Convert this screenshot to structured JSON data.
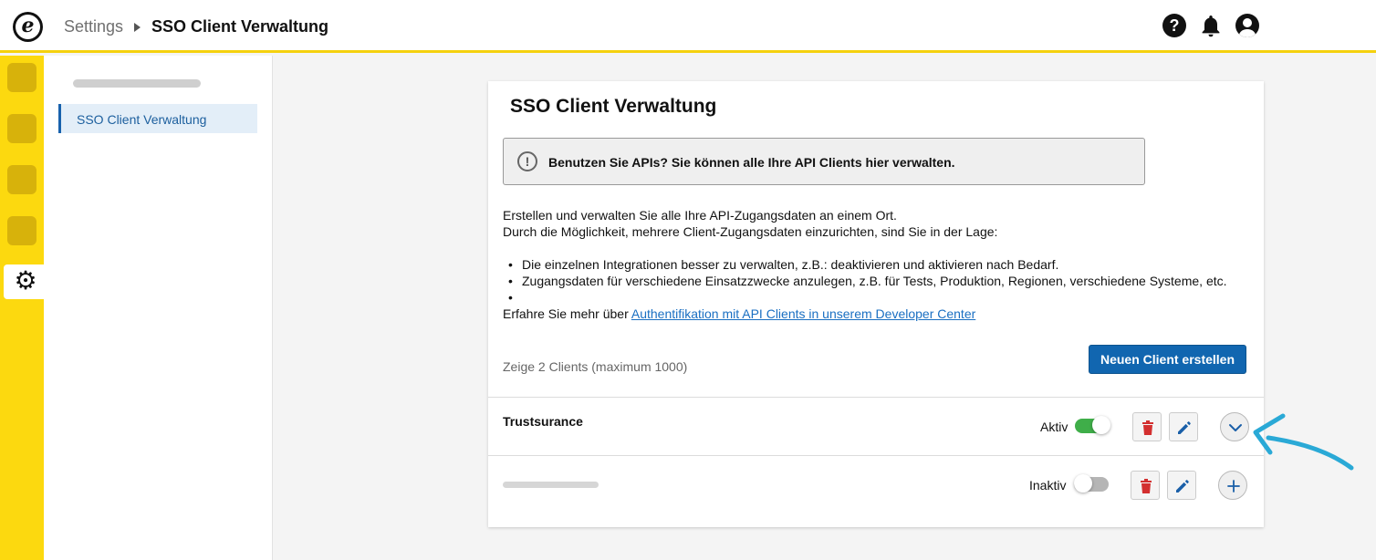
{
  "header": {
    "logo_letter": "e",
    "breadcrumb_root": "Settings",
    "breadcrumb_current": "SSO Client Verwaltung",
    "icons": [
      "help-icon",
      "bell-icon",
      "user-icon"
    ]
  },
  "rail": {
    "items": [
      "rail-item-1",
      "rail-item-2",
      "rail-item-3",
      "rail-item-4"
    ],
    "active_icon": "gear-icon"
  },
  "sidebar": {
    "items": [
      {
        "label": "SSO Client Verwaltung",
        "active": true
      }
    ]
  },
  "card": {
    "title": "SSO Client Verwaltung",
    "info": "Benutzen Sie APIs? Sie können alle Ihre API Clients hier verwalten.",
    "description": [
      "Erstellen und verwalten Sie alle Ihre API-Zugangsdaten an einem Ort.",
      "Durch die Möglichkeit, mehrere Client-Zugangsdaten einzurichten, sind Sie in der Lage:"
    ],
    "bullets": [
      "Die einzelnen Integrationen besser zu verwalten, z.B.: deaktivieren und aktivieren nach Bedarf.",
      "Zugangsdaten für verschiedene Einsatzzwecke anzulegen, z.B. für Tests, Produktion, Regionen, verschiedene Systeme, etc.",
      ""
    ],
    "learn_more_prefix": "Erfahre Sie mehr über ",
    "learn_more_link": "Authentifikation mit API Clients in unserem Developer Center",
    "count_text": "Zeige 2 Clients (maximum 1000)",
    "create_button": "Neuen Client erstellen"
  },
  "clients": [
    {
      "name": "Trustsurance",
      "status": "Aktiv",
      "active": true,
      "expand_icon": "chevron-down-icon"
    },
    {
      "name": "",
      "status": "Inaktiv",
      "active": false,
      "expand_icon": "plus-icon"
    }
  ],
  "colors": {
    "accent_yellow": "#fcd90f",
    "primary_blue": "#1166b0",
    "toggle_on": "#3fae49",
    "delete_red": "#d32f2f",
    "annotation_arrow": "#2aa9d6"
  }
}
